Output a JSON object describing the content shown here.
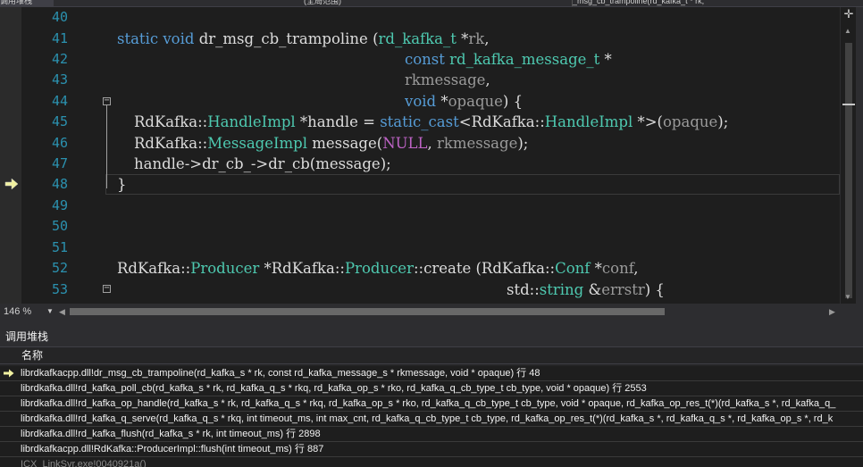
{
  "tabs": [
    {
      "label": "调用堆栈"
    },
    {
      "label": "(全局范围)"
    },
    {
      "label": "_msg_cb_trampoline(rd_kafka_t * rk,"
    }
  ],
  "editor": {
    "line_numbers": [
      "40",
      "41",
      "42",
      "43",
      "44",
      "45",
      "46",
      "47",
      "48",
      "49",
      "50",
      "51",
      "52",
      "53"
    ],
    "code": {
      "l41": {
        "kw1": "static",
        "kw2": "void",
        "name": "dr_msg_cb_trampoline",
        "open": " (",
        "type": "rd_kafka_t",
        "star": " *",
        "param": "rk",
        "comma": ","
      },
      "l42": {
        "kw": "const",
        "type": "rd_kafka_message_t",
        "star": " *"
      },
      "l43": {
        "param": "rkmessage",
        "comma": ","
      },
      "l44": {
        "kw": "void",
        "star": " *",
        "param": "opaque",
        "rest": ") {"
      },
      "l45": {
        "ns": "RdKafka",
        "sep": "::",
        "type": "HandleImpl",
        "mid": " *handle = ",
        "kw": "static_cast",
        "lt": "<",
        "ns2": "RdKafka",
        "sep2": "::",
        "type2": "HandleImpl",
        "gt": " *>(",
        "param": "opaque",
        "end": ");"
      },
      "l46": {
        "ns": "RdKafka",
        "sep": "::",
        "type": "MessageImpl",
        "mid": " message(",
        "macro": "NULL",
        "comma": ", ",
        "param": "rkmessage",
        "end": ");"
      },
      "l47": {
        "text": "handle->dr_cb_->dr_cb(message);"
      },
      "l48": {
        "text": "}"
      },
      "l52": {
        "ns": "RdKafka",
        "sep": "::",
        "type": "Producer",
        "mid": " *",
        "ns2": "RdKafka",
        "sep2": "::",
        "type2": "Producer",
        "fn": "::create",
        "open": " (",
        "ns3": "RdKafka",
        "sep3": "::",
        "type3": "Conf",
        "star": " *",
        "param": "conf",
        "comma": ","
      },
      "l53": {
        "ns": "std",
        "sep": "::",
        "type": "string",
        "amp": " &",
        "param": "errstr",
        "rest": ") {"
      }
    }
  },
  "zoom": {
    "level": "146 %"
  },
  "callstack": {
    "title": "调用堆栈",
    "column_name": "名称",
    "frames": [
      "librdkafkacpp.dll!dr_msg_cb_trampoline(rd_kafka_s * rk, const rd_kafka_message_s * rkmessage, void * opaque) 行 48",
      "librdkafka.dll!rd_kafka_poll_cb(rd_kafka_s * rk, rd_kafka_q_s * rkq, rd_kafka_op_s * rko, rd_kafka_q_cb_type_t cb_type, void * opaque) 行 2553",
      "librdkafka.dll!rd_kafka_op_handle(rd_kafka_s * rk, rd_kafka_q_s * rkq, rd_kafka_op_s * rko, rd_kafka_q_cb_type_t cb_type, void * opaque, rd_kafka_op_res_t(*)(rd_kafka_s *, rd_kafka_q_",
      "librdkafka.dll!rd_kafka_q_serve(rd_kafka_q_s * rkq, int timeout_ms, int max_cnt, rd_kafka_q_cb_type_t cb_type, rd_kafka_op_res_t(*)(rd_kafka_s *, rd_kafka_q_s *, rd_kafka_op_s *, rd_k",
      "librdkafka.dll!rd_kafka_flush(rd_kafka_s * rk, int timeout_ms) 行 2898",
      "librdkafkacpp.dll!RdKafka::ProducerImpl::flush(int timeout_ms) 行 887",
      "ICX_LinkSvr.exe!0040921a()"
    ]
  }
}
